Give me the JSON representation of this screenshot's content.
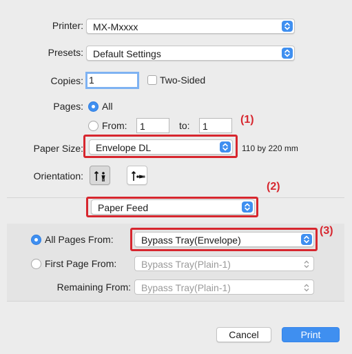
{
  "printer": {
    "label": "Printer:",
    "value": "MX-Mxxxx"
  },
  "presets": {
    "label": "Presets:",
    "value": "Default Settings"
  },
  "copies": {
    "label": "Copies:",
    "value": "1",
    "two_sided_label": "Two-Sided",
    "two_sided_checked": false
  },
  "pages": {
    "label": "Pages:",
    "all_label": "All",
    "from_label": "From:",
    "from_value": "1",
    "to_label": "to:",
    "to_value": "1",
    "selected": "All"
  },
  "paper_size": {
    "label": "Paper Size:",
    "value": "Envelope DL",
    "dimensions": "110 by 220 mm"
  },
  "orientation": {
    "label": "Orientation:",
    "options": [
      "portrait-icon",
      "landscape-icon"
    ],
    "selected": "portrait-icon"
  },
  "section": {
    "value": "Paper Feed"
  },
  "feed": {
    "all_pages_label": "All Pages From:",
    "all_pages_value": "Bypass Tray(Envelope)",
    "first_page_label": "First Page From:",
    "first_page_value": "Bypass Tray(Plain-1)",
    "remaining_label": "Remaining From:",
    "remaining_value": "Bypass Tray(Plain-1)",
    "selected": "All Pages From"
  },
  "callouts": {
    "one": "(1)",
    "two": "(2)",
    "three": "(3)"
  },
  "buttons": {
    "cancel": "Cancel",
    "print": "Print"
  },
  "colors": {
    "accent": "#3f8ff0",
    "callout_red": "#d7262e",
    "background": "#ececec"
  }
}
